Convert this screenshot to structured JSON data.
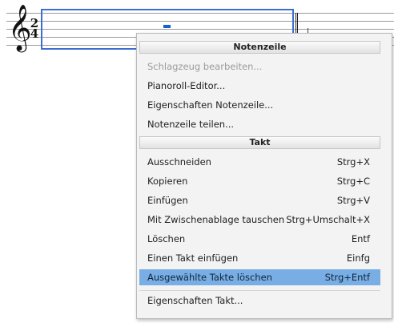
{
  "score": {
    "time_signature": {
      "top": "2",
      "bottom": "4"
    },
    "clef_icon": "treble-clef-icon"
  },
  "menu": {
    "section_staff": {
      "header": "Notenzeile",
      "items": [
        {
          "label": "Schlagzeug bearbeiten...",
          "shortcut": "",
          "enabled": false
        },
        {
          "label": "Pianoroll-Editor...",
          "shortcut": "",
          "enabled": true
        },
        {
          "label": "Eigenschaften Notenzeile...",
          "shortcut": "",
          "enabled": true
        },
        {
          "label": "Notenzeile teilen...",
          "shortcut": "",
          "enabled": true
        }
      ]
    },
    "section_measure": {
      "header": "Takt",
      "items": [
        {
          "label": "Ausschneiden",
          "shortcut": "Strg+X",
          "enabled": true
        },
        {
          "label": "Kopieren",
          "shortcut": "Strg+C",
          "enabled": true
        },
        {
          "label": "Einfügen",
          "shortcut": "Strg+V",
          "enabled": true
        },
        {
          "label": "Mit Zwischenablage tauschen",
          "shortcut": "Strg+Umschalt+X",
          "enabled": true
        },
        {
          "label": "Löschen",
          "shortcut": "Entf",
          "enabled": true
        },
        {
          "label": "Einen Takt einfügen",
          "shortcut": "Einfg",
          "enabled": true
        },
        {
          "label": "Ausgewählte Takte löschen",
          "shortcut": "Strg+Entf",
          "enabled": true,
          "highlighted": true
        }
      ]
    },
    "footer_item": {
      "label": "Eigenschaften Takt...",
      "shortcut": "",
      "enabled": true
    },
    "highlight_color": "#78aee4",
    "selection_color": "#3d6fd0"
  }
}
